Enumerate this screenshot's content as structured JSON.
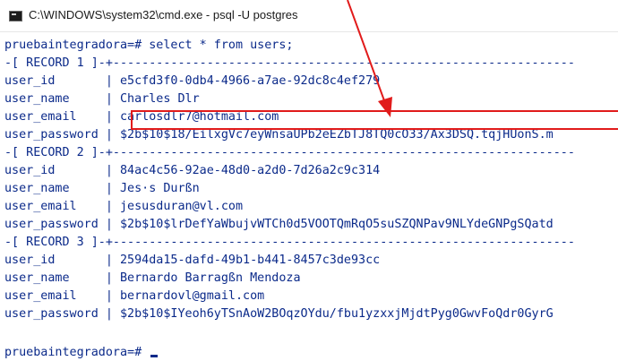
{
  "window": {
    "title": "C:\\WINDOWS\\system32\\cmd.exe - psql  -U postgres"
  },
  "colors": {
    "terminal_text": "#0b2a8a",
    "annotation": "#e11b1b",
    "background": "#ffffff"
  },
  "terminal": {
    "lines": [
      "pruebaintegradora=# select * from users;",
      "-[ RECORD 1 ]-+----------------------------------------------------------------",
      "user_id       | e5cfd3f0-0db4-4966-a7ae-92dc8c4ef279",
      "user_name     | Charles Dlr",
      "user_email    | carlosdlr7@hotmail.com",
      "user_password | $2b$10$18/EilxgVc7eyWnsaUPb2eEZbTJ8TQ0cO33/Ax3DSQ.tqjHUonS.m",
      "-[ RECORD 2 ]-+----------------------------------------------------------------",
      "user_id       | 84ac4c56-92ae-48d0-a2d0-7d26a2c9c314",
      "user_name     | Jes·s Durßn",
      "user_email    | jesusduran@vl.com",
      "user_password | $2b$10$lrDefYaWbujvWTCh0d5VOOTQmRqO5suSZQNPav9NLYdeGNPgSQatd",
      "-[ RECORD 3 ]-+----------------------------------------------------------------",
      "user_id       | 2594da15-dafd-49b1-b441-8457c3de93cc",
      "user_name     | Bernardo Barragßn Mendoza",
      "user_email    | bernardovl@gmail.com",
      "user_password | $2b$10$IYeoh6yTSnAoW2BOqzOYdu/fbu1yzxxjMjdtPyg0GwvFoQdr0GyrG",
      "",
      "",
      "pruebaintegradora=# "
    ]
  }
}
